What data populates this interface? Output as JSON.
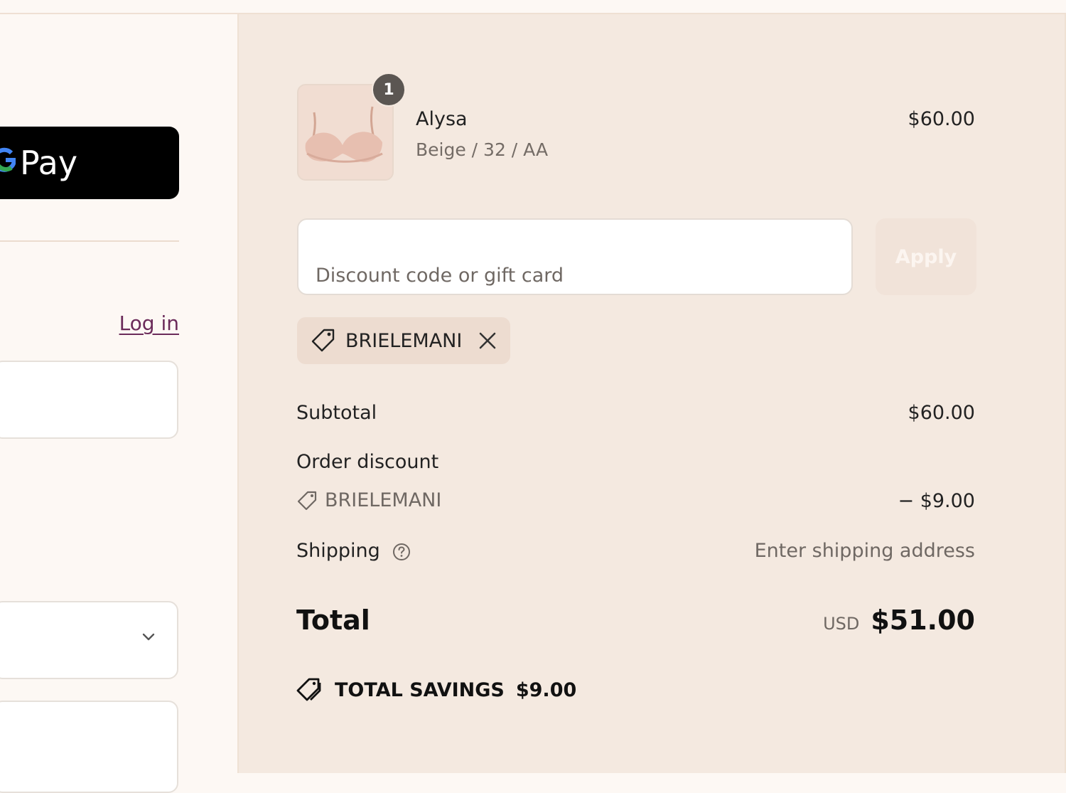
{
  "left": {
    "gpay_label": "Pay",
    "gpay_g": "G",
    "login_link": "Log in"
  },
  "cart": {
    "quantity_badge": "1",
    "product_name": "Alysa",
    "product_variant": "Beige / 32 / AA",
    "product_price": "$60.00"
  },
  "discount": {
    "placeholder": "Discount code or gift card",
    "apply_label": "Apply",
    "applied_code": "BRIELEMANI"
  },
  "summary": {
    "subtotal_label": "Subtotal",
    "subtotal_value": "$60.00",
    "order_discount_label": "Order discount",
    "discount_code": "BRIELEMANI",
    "discount_value": "− $9.00",
    "shipping_label": "Shipping",
    "shipping_value": "Enter shipping address",
    "total_label": "Total",
    "currency": "USD",
    "total_value": "$51.00",
    "savings_label": "TOTAL SAVINGS",
    "savings_value": "$9.00"
  },
  "colors": {
    "right_panel_bg": "#f4e9e0",
    "left_panel_bg": "#fdf8f4",
    "login_link": "#6b2b5a",
    "gpay_button": "#000000"
  },
  "icons": {
    "tag": "tag-icon",
    "close": "close-icon",
    "help": "help-circle-icon",
    "chevron": "chevron-down-icon",
    "savings": "savings-tag-icon"
  }
}
